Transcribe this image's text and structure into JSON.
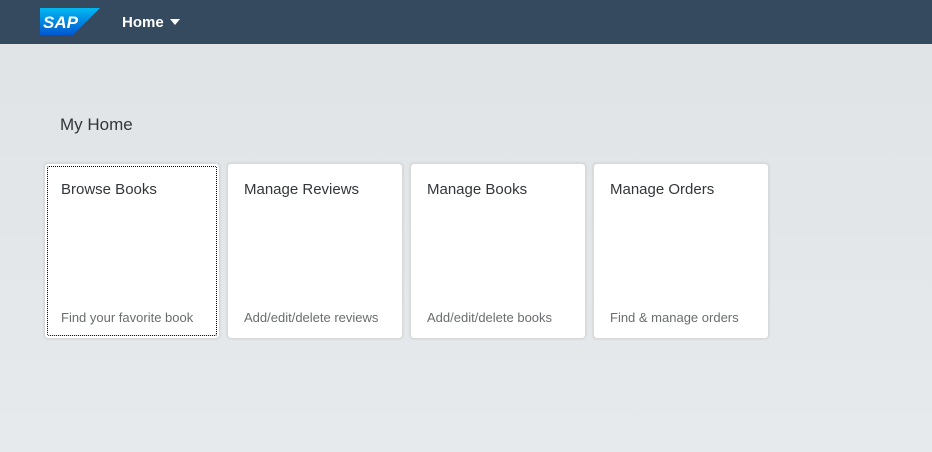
{
  "shellbar": {
    "logo_text": "SAP",
    "home_label": "Home",
    "background": "#354a5f",
    "logo_color": "#0a6ed1"
  },
  "page": {
    "title": "My Home"
  },
  "tiles": [
    {
      "title": "Browse Books",
      "subtitle": "Find your favorite book",
      "focused": true
    },
    {
      "title": "Manage Reviews",
      "subtitle": "Add/edit/delete reviews"
    },
    {
      "title": "Manage Books",
      "subtitle": "Add/edit/delete books"
    },
    {
      "title": "Manage Orders",
      "subtitle": "Find & manage orders"
    }
  ],
  "icons": {
    "home_caret": "chevron-down-icon",
    "logo": "sap-logo"
  }
}
